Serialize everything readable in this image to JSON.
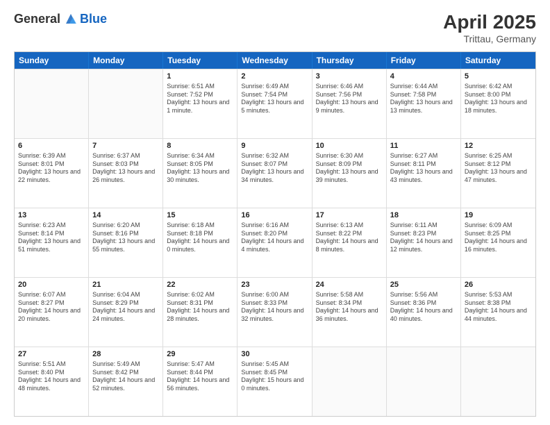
{
  "header": {
    "logo_general": "General",
    "logo_blue": "Blue",
    "title": "April 2025",
    "location": "Trittau, Germany"
  },
  "days_of_week": [
    "Sunday",
    "Monday",
    "Tuesday",
    "Wednesday",
    "Thursday",
    "Friday",
    "Saturday"
  ],
  "weeks": [
    [
      {
        "day": "",
        "sunrise": "",
        "sunset": "",
        "daylight": ""
      },
      {
        "day": "",
        "sunrise": "",
        "sunset": "",
        "daylight": ""
      },
      {
        "day": "1",
        "sunrise": "Sunrise: 6:51 AM",
        "sunset": "Sunset: 7:52 PM",
        "daylight": "Daylight: 13 hours and 1 minute."
      },
      {
        "day": "2",
        "sunrise": "Sunrise: 6:49 AM",
        "sunset": "Sunset: 7:54 PM",
        "daylight": "Daylight: 13 hours and 5 minutes."
      },
      {
        "day": "3",
        "sunrise": "Sunrise: 6:46 AM",
        "sunset": "Sunset: 7:56 PM",
        "daylight": "Daylight: 13 hours and 9 minutes."
      },
      {
        "day": "4",
        "sunrise": "Sunrise: 6:44 AM",
        "sunset": "Sunset: 7:58 PM",
        "daylight": "Daylight: 13 hours and 13 minutes."
      },
      {
        "day": "5",
        "sunrise": "Sunrise: 6:42 AM",
        "sunset": "Sunset: 8:00 PM",
        "daylight": "Daylight: 13 hours and 18 minutes."
      }
    ],
    [
      {
        "day": "6",
        "sunrise": "Sunrise: 6:39 AM",
        "sunset": "Sunset: 8:01 PM",
        "daylight": "Daylight: 13 hours and 22 minutes."
      },
      {
        "day": "7",
        "sunrise": "Sunrise: 6:37 AM",
        "sunset": "Sunset: 8:03 PM",
        "daylight": "Daylight: 13 hours and 26 minutes."
      },
      {
        "day": "8",
        "sunrise": "Sunrise: 6:34 AM",
        "sunset": "Sunset: 8:05 PM",
        "daylight": "Daylight: 13 hours and 30 minutes."
      },
      {
        "day": "9",
        "sunrise": "Sunrise: 6:32 AM",
        "sunset": "Sunset: 8:07 PM",
        "daylight": "Daylight: 13 hours and 34 minutes."
      },
      {
        "day": "10",
        "sunrise": "Sunrise: 6:30 AM",
        "sunset": "Sunset: 8:09 PM",
        "daylight": "Daylight: 13 hours and 39 minutes."
      },
      {
        "day": "11",
        "sunrise": "Sunrise: 6:27 AM",
        "sunset": "Sunset: 8:11 PM",
        "daylight": "Daylight: 13 hours and 43 minutes."
      },
      {
        "day": "12",
        "sunrise": "Sunrise: 6:25 AM",
        "sunset": "Sunset: 8:12 PM",
        "daylight": "Daylight: 13 hours and 47 minutes."
      }
    ],
    [
      {
        "day": "13",
        "sunrise": "Sunrise: 6:23 AM",
        "sunset": "Sunset: 8:14 PM",
        "daylight": "Daylight: 13 hours and 51 minutes."
      },
      {
        "day": "14",
        "sunrise": "Sunrise: 6:20 AM",
        "sunset": "Sunset: 8:16 PM",
        "daylight": "Daylight: 13 hours and 55 minutes."
      },
      {
        "day": "15",
        "sunrise": "Sunrise: 6:18 AM",
        "sunset": "Sunset: 8:18 PM",
        "daylight": "Daylight: 14 hours and 0 minutes."
      },
      {
        "day": "16",
        "sunrise": "Sunrise: 6:16 AM",
        "sunset": "Sunset: 8:20 PM",
        "daylight": "Daylight: 14 hours and 4 minutes."
      },
      {
        "day": "17",
        "sunrise": "Sunrise: 6:13 AM",
        "sunset": "Sunset: 8:22 PM",
        "daylight": "Daylight: 14 hours and 8 minutes."
      },
      {
        "day": "18",
        "sunrise": "Sunrise: 6:11 AM",
        "sunset": "Sunset: 8:23 PM",
        "daylight": "Daylight: 14 hours and 12 minutes."
      },
      {
        "day": "19",
        "sunrise": "Sunrise: 6:09 AM",
        "sunset": "Sunset: 8:25 PM",
        "daylight": "Daylight: 14 hours and 16 minutes."
      }
    ],
    [
      {
        "day": "20",
        "sunrise": "Sunrise: 6:07 AM",
        "sunset": "Sunset: 8:27 PM",
        "daylight": "Daylight: 14 hours and 20 minutes."
      },
      {
        "day": "21",
        "sunrise": "Sunrise: 6:04 AM",
        "sunset": "Sunset: 8:29 PM",
        "daylight": "Daylight: 14 hours and 24 minutes."
      },
      {
        "day": "22",
        "sunrise": "Sunrise: 6:02 AM",
        "sunset": "Sunset: 8:31 PM",
        "daylight": "Daylight: 14 hours and 28 minutes."
      },
      {
        "day": "23",
        "sunrise": "Sunrise: 6:00 AM",
        "sunset": "Sunset: 8:33 PM",
        "daylight": "Daylight: 14 hours and 32 minutes."
      },
      {
        "day": "24",
        "sunrise": "Sunrise: 5:58 AM",
        "sunset": "Sunset: 8:34 PM",
        "daylight": "Daylight: 14 hours and 36 minutes."
      },
      {
        "day": "25",
        "sunrise": "Sunrise: 5:56 AM",
        "sunset": "Sunset: 8:36 PM",
        "daylight": "Daylight: 14 hours and 40 minutes."
      },
      {
        "day": "26",
        "sunrise": "Sunrise: 5:53 AM",
        "sunset": "Sunset: 8:38 PM",
        "daylight": "Daylight: 14 hours and 44 minutes."
      }
    ],
    [
      {
        "day": "27",
        "sunrise": "Sunrise: 5:51 AM",
        "sunset": "Sunset: 8:40 PM",
        "daylight": "Daylight: 14 hours and 48 minutes."
      },
      {
        "day": "28",
        "sunrise": "Sunrise: 5:49 AM",
        "sunset": "Sunset: 8:42 PM",
        "daylight": "Daylight: 14 hours and 52 minutes."
      },
      {
        "day": "29",
        "sunrise": "Sunrise: 5:47 AM",
        "sunset": "Sunset: 8:44 PM",
        "daylight": "Daylight: 14 hours and 56 minutes."
      },
      {
        "day": "30",
        "sunrise": "Sunrise: 5:45 AM",
        "sunset": "Sunset: 8:45 PM",
        "daylight": "Daylight: 15 hours and 0 minutes."
      },
      {
        "day": "",
        "sunrise": "",
        "sunset": "",
        "daylight": ""
      },
      {
        "day": "",
        "sunrise": "",
        "sunset": "",
        "daylight": ""
      },
      {
        "day": "",
        "sunrise": "",
        "sunset": "",
        "daylight": ""
      }
    ]
  ]
}
